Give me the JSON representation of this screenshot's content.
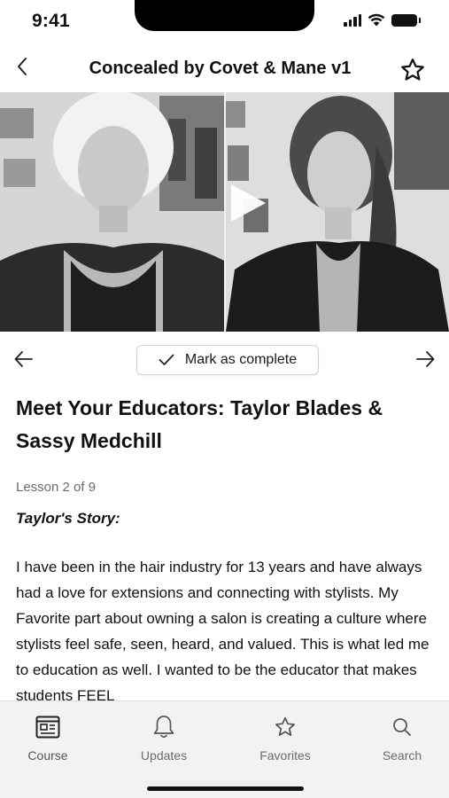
{
  "status_bar": {
    "time": "9:41"
  },
  "header": {
    "title": "Concealed by Covet & Mane v1",
    "back_icon": "chevron-left-icon",
    "favorite_icon": "star-outline-icon"
  },
  "video": {
    "play_icon": "play-icon"
  },
  "controls": {
    "mark_complete_label": "Mark as complete",
    "prev_icon": "arrow-left-icon",
    "next_icon": "arrow-right-icon",
    "check_icon": "check-icon"
  },
  "lesson": {
    "title": "Meet Your Educators: Taylor Blades & Sassy Medchill",
    "progress": "Lesson 2 of 9",
    "story_heading": "Taylor's Story:",
    "story_body": "I have been in the hair industry for 13 years and have always had a love for extensions and connecting with stylists. My Favorite part about owning a salon is creating a culture where stylists feel safe, seen, heard, and valued. This is what led me to education as well. I wanted to be the educator that makes students FEEL"
  },
  "tabbar": {
    "tabs": [
      {
        "label": "Course",
        "icon": "course-icon",
        "active": true
      },
      {
        "label": "Updates",
        "icon": "bell-icon",
        "active": false
      },
      {
        "label": "Favorites",
        "icon": "star-icon",
        "active": false
      },
      {
        "label": "Search",
        "icon": "search-icon",
        "active": false
      }
    ]
  }
}
